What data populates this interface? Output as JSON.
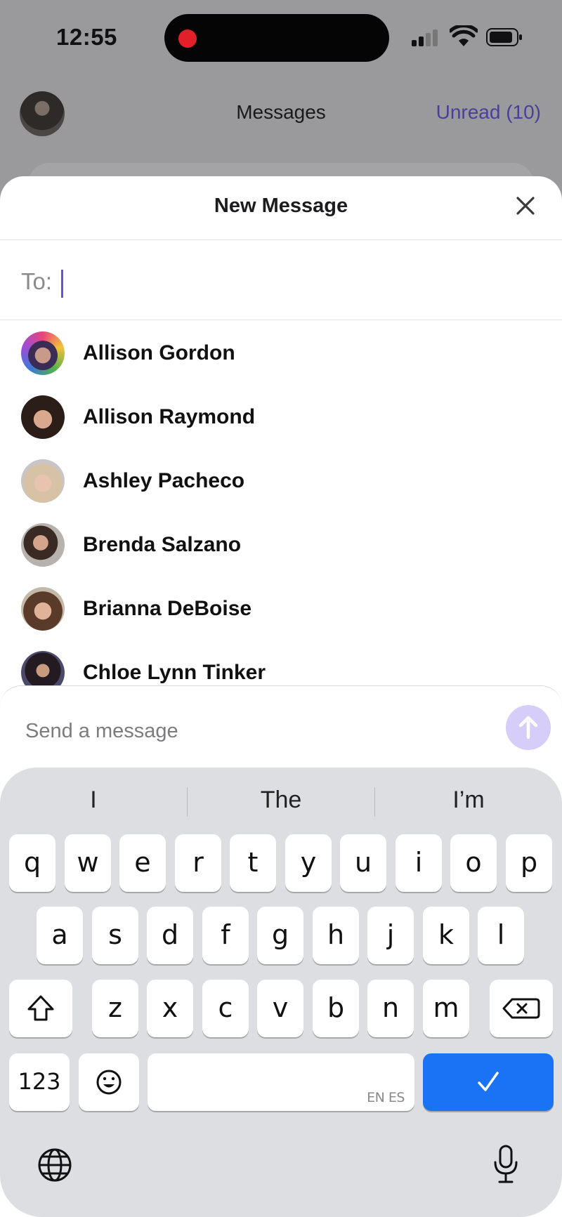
{
  "status_bar": {
    "time": "12:55"
  },
  "background": {
    "title": "Messages",
    "unread_label": "Unread (10)"
  },
  "sheet": {
    "title": "New Message",
    "to_label": "To:",
    "to_value": ""
  },
  "contacts": [
    {
      "name": "Allison Gordon"
    },
    {
      "name": "Allison Raymond"
    },
    {
      "name": "Ashley Pacheco"
    },
    {
      "name": "Brenda Salzano"
    },
    {
      "name": "Brianna DeBoise"
    },
    {
      "name": "Chloe Lynn Tinker"
    }
  ],
  "compose": {
    "placeholder": "Send a message"
  },
  "keyboard": {
    "suggestions": [
      "I",
      "The",
      "I’m"
    ],
    "row1": [
      "q",
      "w",
      "e",
      "r",
      "t",
      "y",
      "u",
      "i",
      "o",
      "p"
    ],
    "row2": [
      "a",
      "s",
      "d",
      "f",
      "g",
      "h",
      "j",
      "k",
      "l"
    ],
    "row3": [
      "z",
      "x",
      "c",
      "v",
      "b",
      "n",
      "m"
    ],
    "numbers_label": "123",
    "space_languages": "EN ES"
  },
  "colors": {
    "accent": "#6a4fe0",
    "send_button": "#d6cdf8",
    "done_key": "#1a73f5",
    "unread_text": "#4a3f9a"
  }
}
